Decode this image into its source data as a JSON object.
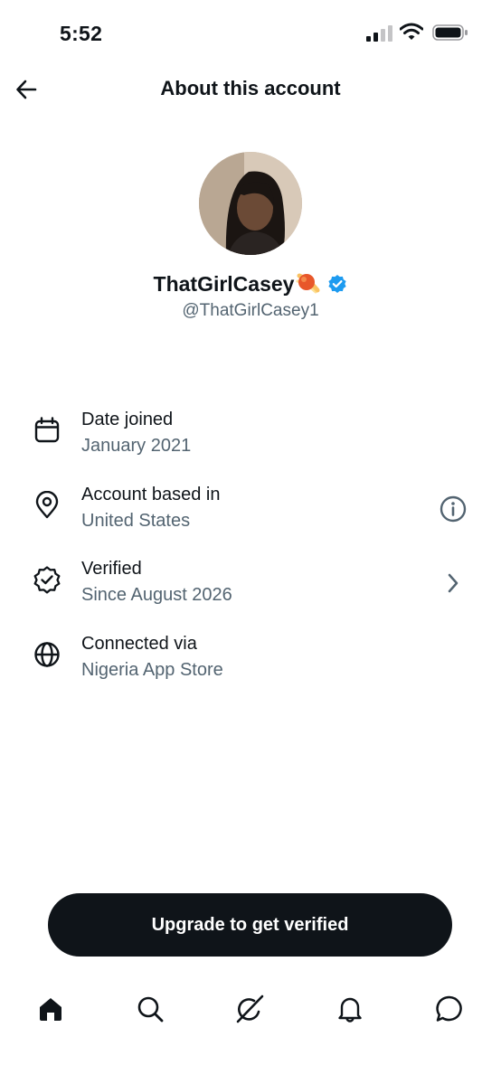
{
  "status_bar": {
    "time": "5:52",
    "icons": [
      "cellular-signal-icon",
      "wifi-icon",
      "battery-icon"
    ]
  },
  "header": {
    "title": "About this account",
    "back_icon": "arrow-left-icon"
  },
  "profile": {
    "display_name": "ThatGirlCasey",
    "emoji_icon": "comet-emoji-icon",
    "verified_icon": "verified-badge-icon",
    "verified_color": "#1d9bf0",
    "handle": "@ThatGirlCasey1"
  },
  "info_rows": [
    {
      "icon": "calendar-icon",
      "label": "Date joined",
      "value": "January 2021"
    },
    {
      "icon": "location-pin-icon",
      "label": "Account based in",
      "value": "United States",
      "action_icon": "info-icon"
    },
    {
      "icon": "verified-outline-icon",
      "label": "Verified",
      "value": "Since August 2026",
      "action_icon": "chevron-right-icon"
    },
    {
      "icon": "globe-icon",
      "label": "Connected via",
      "value": "Nigeria App Store"
    }
  ],
  "upgrade_button": {
    "label": "Upgrade to get verified"
  },
  "tab_bar": {
    "tabs": [
      "home-icon",
      "search-icon",
      "grok-icon",
      "notifications-bell-icon",
      "messages-icon"
    ],
    "active": "home-icon"
  },
  "colors": {
    "text_primary": "#0f1419",
    "text_secondary": "#536471",
    "button_bg": "#0f1419",
    "accent": "#1d9bf0"
  }
}
